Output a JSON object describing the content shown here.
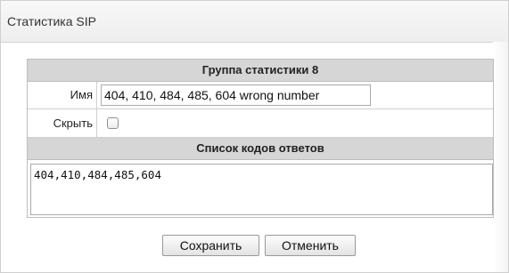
{
  "window": {
    "title": "Статистика SIP"
  },
  "form": {
    "group_header": "Группа статистики 8",
    "name_label": "Имя",
    "name_value": "404, 410, 484, 485, 604 wrong number",
    "hide_label": "Скрыть",
    "hide_checked": false,
    "codes_header": "Список кодов ответов",
    "codes_value": "404,410,484,485,604"
  },
  "buttons": {
    "save_label": "Сохранить",
    "cancel_label": "Отменить"
  }
}
